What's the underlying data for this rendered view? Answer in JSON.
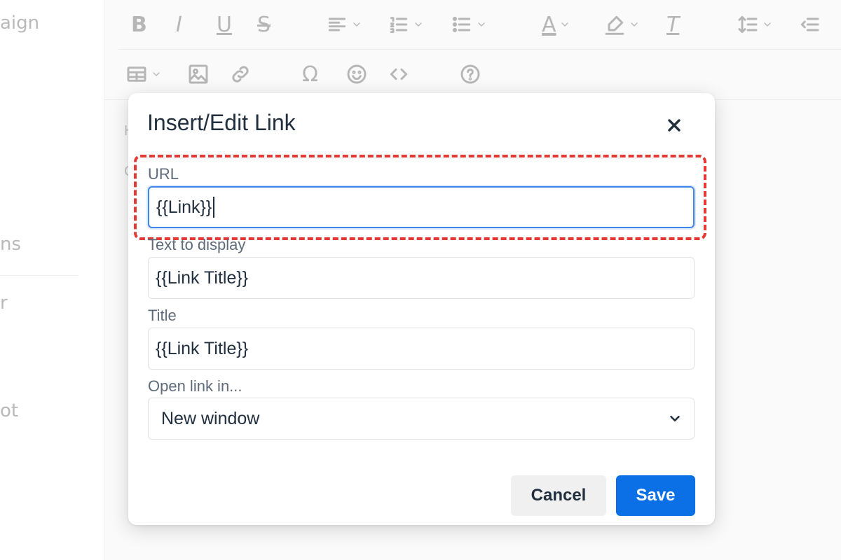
{
  "background": {
    "sidebar_fragments": [
      "aign",
      "ns",
      "r",
      "ot"
    ],
    "editor_fragments": [
      "H",
      "C"
    ],
    "toolbar": {
      "bold": "B",
      "italic": "I",
      "underline": "U",
      "strikethrough": "S",
      "text_color_glyph": "A",
      "clear_format_glyph": "T",
      "special_char_glyph": "Ω",
      "help_glyph": "?",
      "code_glyph": "<>"
    }
  },
  "dialog": {
    "title": "Insert/Edit Link",
    "url_label": "URL",
    "url_value": "{{Link}}",
    "text_label": "Text to display",
    "text_value": "{{Link Title}}",
    "title_label": "Title",
    "title_value": "{{Link Title}}",
    "target_label": "Open link in...",
    "target_value": "New window",
    "cancel_label": "Cancel",
    "save_label": "Save"
  },
  "colors": {
    "primary": "#0b6fe5",
    "focus": "#3f86e8",
    "highlight": "#e53935"
  },
  "icons": [
    "close-icon",
    "chevron-down-icon",
    "table-icon",
    "image-icon",
    "link-icon",
    "emoji-icon",
    "help-icon",
    "line-height-icon",
    "outdent-icon",
    "align-left-icon",
    "numbered-list-icon",
    "bullet-list-icon",
    "highlight-icon"
  ]
}
